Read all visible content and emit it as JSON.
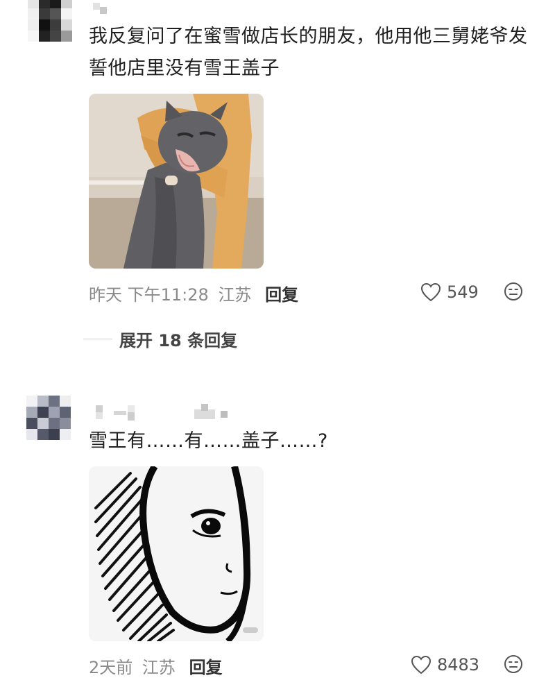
{
  "comments": [
    {
      "text": "我反复问了在蜜雪做店长的朋友，他用他三舅姥爷发誓他店里没有雪王盖子",
      "image_alt": "cat being held, mouth open yelling",
      "time": "昨天 下午11:28",
      "location": "江苏",
      "reply_label": "回复",
      "likes": "549",
      "expand_replies_label": "展开 18 条回复"
    },
    {
      "text": "雪王有……有……盖子……?",
      "image_alt": "ink sketch face staring meme",
      "time": "2天前",
      "location": "江苏",
      "reply_label": "回复",
      "likes": "8483"
    }
  ],
  "icons": {
    "like": "heart-outline-icon",
    "emoji": "neutral-face-icon"
  },
  "colors": {
    "meta_gray": "#8a8a8a",
    "text_dark": "#1f1f1f"
  }
}
